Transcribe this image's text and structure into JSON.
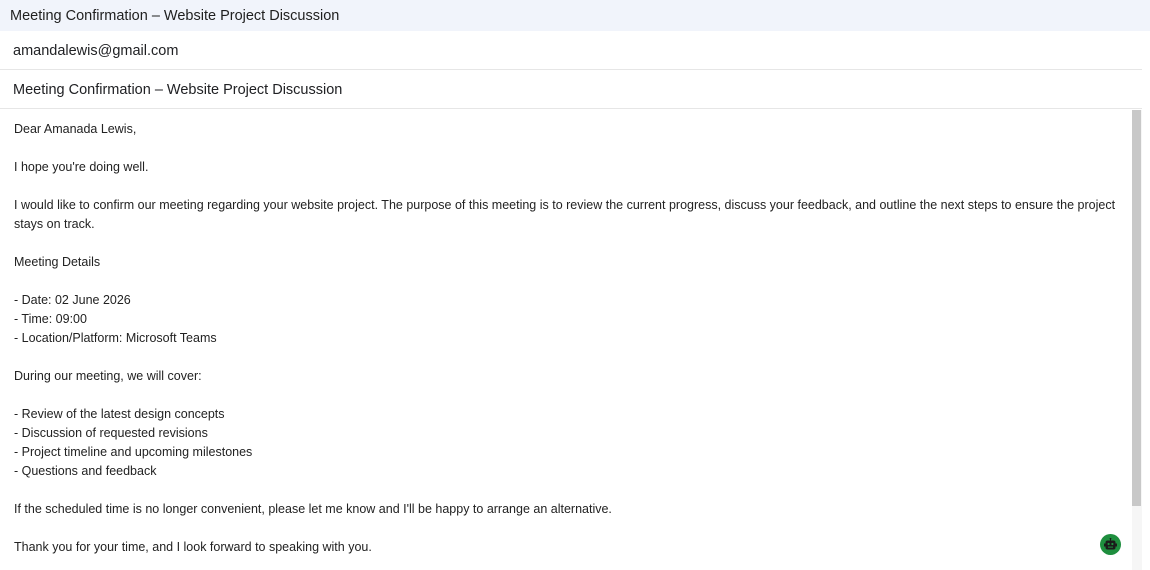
{
  "window": {
    "title": "Meeting Confirmation – Website Project Discussion"
  },
  "compose": {
    "to": "amandalewis@gmail.com",
    "subject": "Meeting Confirmation – Website Project Discussion",
    "body": "Dear Amanada Lewis,\n\nI hope you're doing well.\n\nI would like to confirm our meeting regarding your website project. The purpose of this meeting is to review the current progress, discuss your feedback, and outline the next steps to ensure the project stays on track.\n\nMeeting Details\n\n- Date: 02 June 2026\n- Time: 09:00\n- Location/Platform: Microsoft Teams\n\nDuring our meeting, we will cover:\n\n- Review of the latest design concepts\n- Discussion of requested revisions\n- Project timeline and upcoming milestones\n- Questions and feedback\n\nIf the scheduled time is no longer convenient, please let me know and I'll be happy to arrange an alternative.\n\nThank you for your time, and I look forward to speaking with you."
  },
  "icons": {
    "assistant": "robot-icon"
  },
  "colors": {
    "titlebar_bg": "#f1f4fb",
    "assistant_green": "#1e8e3e"
  }
}
